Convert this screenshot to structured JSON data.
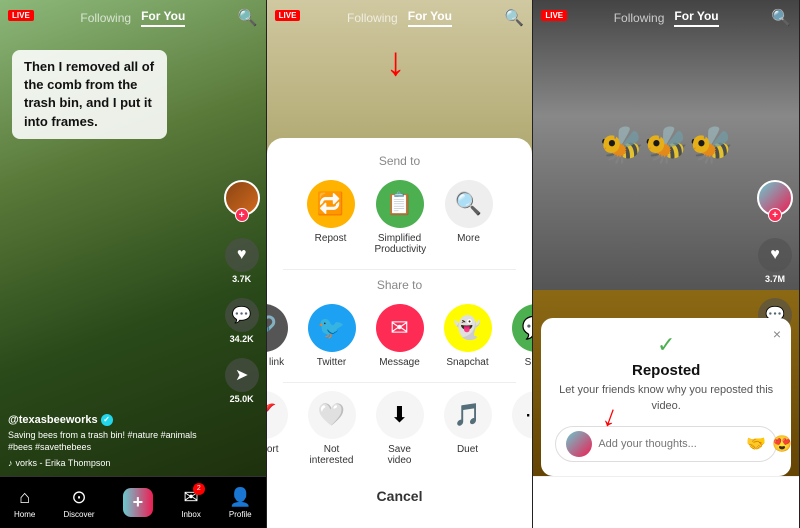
{
  "panels": [
    {
      "id": "panel1",
      "live_badge": "LIVE",
      "nav": {
        "following": "Following",
        "for_you": "For You",
        "active": "For You"
      },
      "caption": "Then I removed all of the comb from the trash bin, and I put it into frames.",
      "actions": {
        "like_count": "3.7K",
        "comment_count": "34.2K",
        "share_count": "25.0K"
      },
      "username": "@texasbeeworks",
      "verified": true,
      "description": "Saving bees from a trash bin! #nature #animals #bees #savethebees",
      "music": "vorks - Erika Thompson",
      "bottom_nav": {
        "home": "Home",
        "discover": "Discover",
        "inbox": "Inbox",
        "inbox_badge": "2",
        "profile": "Profile"
      }
    },
    {
      "id": "panel2",
      "live_badge": "LIVE",
      "nav": {
        "following": "Following",
        "for_you": "For You",
        "active": "For You"
      },
      "share_sheet": {
        "send_to_label": "Send to",
        "share_to_label": "Share to",
        "send_items": [
          {
            "label": "Repost",
            "color": "#FFB300",
            "icon": "🔁"
          },
          {
            "label": "Simplified\nProductivity",
            "color": "#4CAF50",
            "icon": "📋"
          },
          {
            "label": "More",
            "color": "#eee",
            "icon": "🔍"
          }
        ],
        "share_items": [
          {
            "label": "Copy link",
            "color": "#333",
            "icon": "🔗"
          },
          {
            "label": "Twitter",
            "color": "#1da1f2",
            "icon": "🐦"
          },
          {
            "label": "Message",
            "color": "#fe2c55",
            "icon": "✉"
          },
          {
            "label": "Snapchat",
            "color": "#FFFC00",
            "icon": "👻"
          },
          {
            "label": "SMS",
            "color": "#4CAF50",
            "icon": "💬"
          }
        ],
        "actions": [
          {
            "label": "Report",
            "icon": "🚩"
          },
          {
            "label": "Not\ninterested",
            "icon": "🤍"
          },
          {
            "label": "Save video",
            "icon": "⬇"
          },
          {
            "label": "Duet",
            "icon": "🎵"
          },
          {
            "label": "",
            "icon": "⋯"
          }
        ],
        "cancel": "Cancel"
      }
    },
    {
      "id": "panel3",
      "live_badge": "LIVE",
      "nav": {
        "following": "Following",
        "for_you": "For You",
        "active": "For You"
      },
      "reposted_modal": {
        "close": "×",
        "check": "✓",
        "title": "Reposted",
        "description": "Let your friends know why you reposted this video.",
        "placeholder": "Add your thoughts...",
        "emoji1": "🤝",
        "emoji2": "😍"
      }
    }
  ]
}
